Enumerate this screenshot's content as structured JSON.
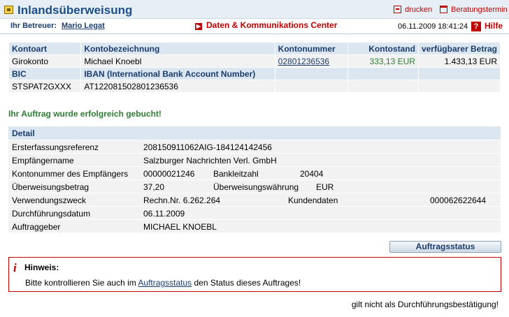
{
  "header": {
    "title": "Inlandsüberweisung",
    "print_label": "drucken",
    "appointment_label": "Beratungstermin"
  },
  "infobar": {
    "advisor_label": "Ihr Betreuer:",
    "advisor_name": "Mario Legat",
    "data_center_label": "Daten & Kommunikations Center",
    "datetime": "06.11.2009 18:41:24",
    "help_label": "Hilfe"
  },
  "account": {
    "headers": [
      "Kontoart",
      "Kontobezeichnung",
      "Kontonummer",
      "Kontostand",
      "verfügbarer Betrag"
    ],
    "type": "Girokonto",
    "name": "Michael Knoebl",
    "number": "02801236536",
    "balance": "333,13 EUR",
    "available": "1.433,13 EUR",
    "bic_label": "BIC",
    "iban_label": "IBAN (International Bank Account Number)",
    "bic": "STSPAT2GXXX",
    "iban": "AT122081502801236536"
  },
  "success_message": "Ihr Auftrag wurde erfolgreich gebucht!",
  "detail": {
    "header": "Detail",
    "rows": [
      {
        "label": "Ersterfassungsreferenz",
        "value": "208150911062AIG-184124142456"
      },
      {
        "label": "Empfängername",
        "value": "Salzburger Nachrichten Verl. GmbH"
      },
      {
        "label": "Kontonummer des Empfängers",
        "value": "00000021246",
        "label2": "Bankleitzahl",
        "value2": "20404"
      },
      {
        "label": "Überweisungsbetrag",
        "value": "37,20",
        "label2": "Überweisungswährung",
        "value2": "EUR"
      },
      {
        "label": "Verwendungszweck",
        "value": "Rechn.Nr. 6.262.264",
        "label2": "Kundendaten",
        "value2": "000062622644"
      },
      {
        "label": "Durchführungsdatum",
        "value": "06.11.2009"
      },
      {
        "label": "Auftraggeber",
        "value": "MICHAEL KNOEBL"
      }
    ]
  },
  "status_button": "Auftragsstatus",
  "notice": {
    "icon": "info-icon",
    "title": "Hinweis:",
    "text_before": "Bitte kontrollieren Sie auch im ",
    "link": "Auftragsstatus",
    "text_after": " den Status dieses Auftrages!"
  },
  "footer_note": "gilt nicht als Durchführungsbestätigung!",
  "colors": {
    "brand": "#1b4f8a",
    "accent_red": "#c00000",
    "success_green": "#2e7d32",
    "header_bg": "#dbe6f1"
  }
}
